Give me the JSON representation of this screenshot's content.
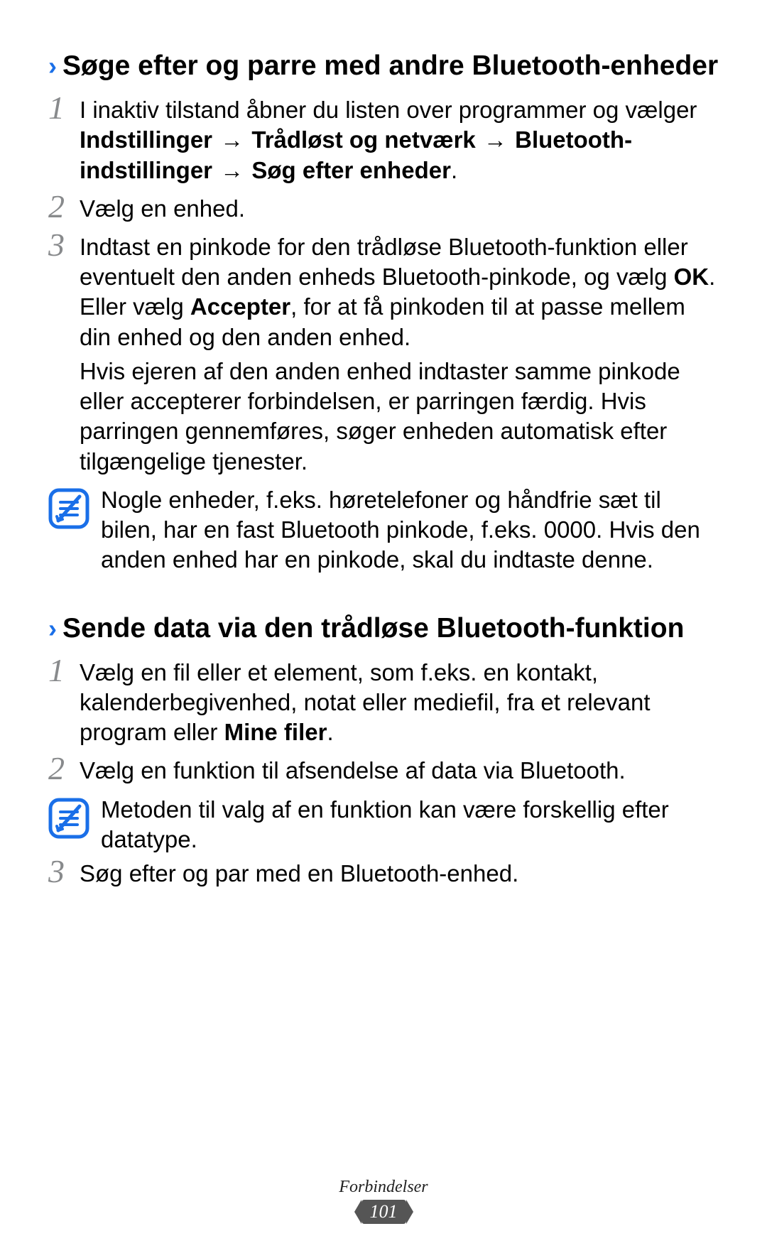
{
  "section1": {
    "heading": "Søge efter og parre med andre Bluetooth-enheder",
    "step1": {
      "num": "1",
      "prefix": "I inaktiv tilstand åbner du listen over programmer og vælger ",
      "nav1": "Indstillinger",
      "nav2": "Trådløst og netværk",
      "nav3": "Bluetooth-indstillinger",
      "nav4": "Søg efter enheder",
      "suffix": "."
    },
    "step2": {
      "num": "2",
      "text": "Vælg en enhed."
    },
    "step3": {
      "num": "3",
      "p1_a": "Indtast en pinkode for den trådløse Bluetooth-funktion eller eventuelt den anden enheds Bluetooth-pinkode, og vælg ",
      "p1_ok": "OK",
      "p1_b": ". Eller vælg ",
      "p1_accept": "Accepter",
      "p1_c": ", for at få pinkoden til at passe mellem din enhed og den anden enhed.",
      "p2": "Hvis ejeren af den anden enhed indtaster samme pinkode eller accepterer forbindelsen, er parringen færdig. Hvis parringen gennemføres, søger enheden automatisk efter tilgængelige tjenester."
    },
    "note": "Nogle enheder, f.eks. høretelefoner og håndfrie sæt til bilen, har en fast Bluetooth pinkode, f.eks. 0000. Hvis den anden enhed har en pinkode, skal du indtaste denne."
  },
  "section2": {
    "heading": "Sende data via den trådløse Bluetooth-funktion",
    "step1": {
      "num": "1",
      "a": "Vælg en fil eller et element, som f.eks. en kontakt, kalenderbegivenhed, notat eller mediefil, fra et relevant program eller ",
      "mf": "Mine filer",
      "b": "."
    },
    "step2": {
      "num": "2",
      "text": "Vælg en funktion til afsendelse af data via Bluetooth."
    },
    "note": "Metoden til valg af en funktion kan være forskellig efter datatype.",
    "step3": {
      "num": "3",
      "text": "Søg efter og par med en Bluetooth-enhed."
    }
  },
  "footer": {
    "section": "Forbindelser",
    "page": "101"
  },
  "arrow": "→"
}
